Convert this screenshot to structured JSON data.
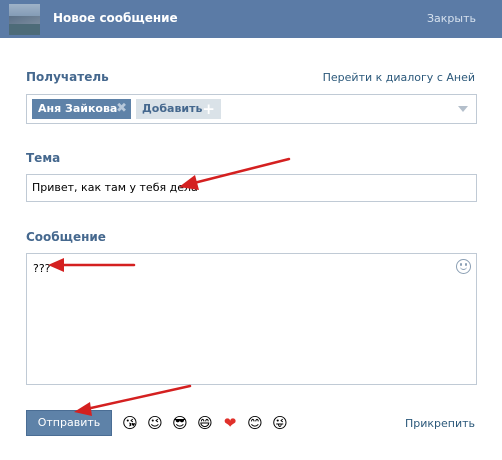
{
  "header": {
    "title": "Новое сообщение",
    "close_label": "Закрыть",
    "color": "#5b7ba6"
  },
  "recipient": {
    "label": "Получатель",
    "goto_dialog_link": "Перейти к диалогу с Аней",
    "chip_name": "Аня Зайкова",
    "add_label": "Добавить"
  },
  "subject": {
    "label": "Тема",
    "value": "Привет, как там у тебя дела"
  },
  "message": {
    "label": "Сообщение",
    "value": "???"
  },
  "footer": {
    "send_label": "Отправить",
    "attach_label": "Прикрепить",
    "emojis": [
      "😘",
      "😉",
      "😎",
      "😄",
      "❤",
      "😊",
      "😜"
    ]
  },
  "annotation_color": "#d42020"
}
